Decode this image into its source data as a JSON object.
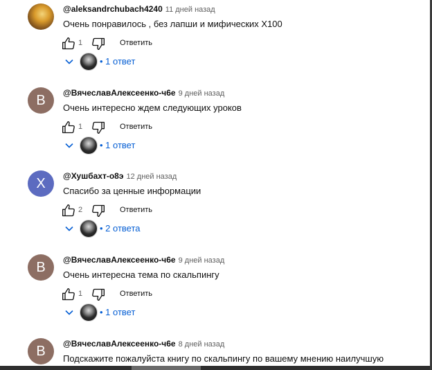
{
  "comments": [
    {
      "author": "@aleksandrchubach4240",
      "time": "11 дней назад",
      "text": "Очень понравилось , без лапши и мифических Х100",
      "avatar_letter": "",
      "avatar_color": "#c7902e",
      "likes": "1",
      "reply_label": "Ответить",
      "replies_label": "1 ответ"
    },
    {
      "author": "@ВячеславАлексеенко-ч6е",
      "time": "9 дней назад",
      "text": "Очень интересно ждем следующих уроков",
      "avatar_letter": "В",
      "avatar_color": "#8d6e63",
      "likes": "1",
      "reply_label": "Ответить",
      "replies_label": "1 ответ"
    },
    {
      "author": "@Хушбахт-о8э",
      "time": "12 дней назад",
      "text": "Спасибо за ценные информации",
      "avatar_letter": "Х",
      "avatar_color": "#5c6bc0",
      "likes": "2",
      "reply_label": "Ответить",
      "replies_label": "2 ответа"
    },
    {
      "author": "@ВячеславАлексеенко-ч6е",
      "time": "9 дней назад",
      "text": "Очень интересна тема по скальпингу",
      "avatar_letter": "В",
      "avatar_color": "#8d6e63",
      "likes": "1",
      "reply_label": "Ответить",
      "replies_label": "1 ответ"
    },
    {
      "author": "@ВячеславАлексеенко-ч6е",
      "time": "8 дней назад",
      "text": "Подскажите пожалуйста  книгу по скальпингу по вашему мнению наилучшую",
      "avatar_letter": "В",
      "avatar_color": "#8d6e63"
    }
  ],
  "colors": {
    "link_blue": "#065fd4",
    "meta_gray": "#606060"
  },
  "icons": [
    "thumbs-up-icon",
    "thumbs-down-icon",
    "chevron-down-icon"
  ]
}
